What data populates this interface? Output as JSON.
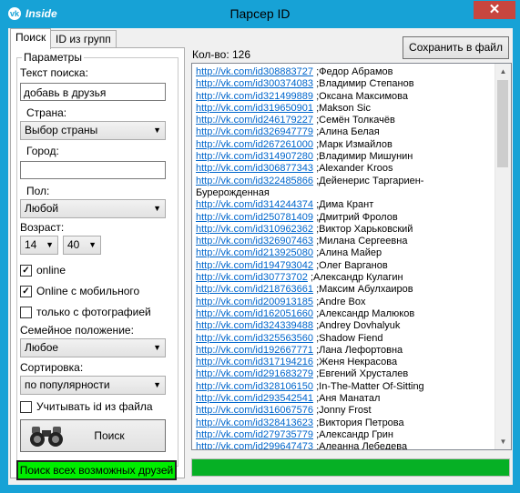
{
  "titlebar": {
    "logo_glyph": "vk",
    "logo_text": "Inside",
    "title": "Парсер ID",
    "close_glyph": "✕"
  },
  "tabs": [
    {
      "label": "Поиск",
      "active": true
    },
    {
      "label": "ID из групп",
      "active": false
    }
  ],
  "params": {
    "group_title": "Параметры",
    "search_text_label": "Текст поиска:",
    "search_text_value": "добавь в друзья",
    "country_label": "Страна:",
    "country_value": "Выбор страны",
    "city_label": "Город:",
    "city_value": "",
    "gender_label": "Пол:",
    "gender_value": "Любой",
    "age_label": "Возраст:",
    "age_from": "14",
    "age_to": "40",
    "online_label": "online",
    "online_checked": true,
    "online_mobile_label": "Online с мобильного",
    "online_mobile_checked": true,
    "photo_only_label": "только с фотографией",
    "photo_only_checked": false,
    "family_label": "Семейное положение:",
    "family_value": "Любое",
    "sort_label": "Сортировка:",
    "sort_value": "по популярности",
    "use_file_ids_label": "Учитывать id из файла",
    "use_file_ids_checked": false,
    "search_button_label": "Поиск",
    "check_glyph": "✓",
    "dropdown_glyph": "▼"
  },
  "search_all_button_label": "Поиск всех возможных друзей",
  "results": {
    "count_label": "Кол-во: 126",
    "save_button_label": "Сохранить в файл",
    "rows": [
      {
        "url": "http://vk.com/id308883727",
        "name": " ;Федор Абрамов"
      },
      {
        "url": "http://vk.com/id300374083",
        "name": " ;Владимир Степанов"
      },
      {
        "url": "http://vk.com/id321499889",
        "name": " ;Оксана Максимова"
      },
      {
        "url": "http://vk.com/id319650901",
        "name": " ;Makson Sic"
      },
      {
        "url": "http://vk.com/id246179227",
        "name": " ;Семён Толкачёв"
      },
      {
        "url": "http://vk.com/id326947779",
        "name": " ;Алина Белая"
      },
      {
        "url": "http://vk.com/id267261000",
        "name": " ;Марк Измайлов"
      },
      {
        "url": "http://vk.com/id314907280",
        "name": " ;Владимир Мишунин"
      },
      {
        "url": "http://vk.com/id306877343",
        "name": " ;Alexander Kroos"
      },
      {
        "url": "http://vk.com/id322485866",
        "name": " ;Дейенерис Таргариен-"
      },
      {
        "url": "",
        "name": "Бурерожденная"
      },
      {
        "url": "http://vk.com/id314244374",
        "name": " ;Дима Крант"
      },
      {
        "url": "http://vk.com/id250781409",
        "name": " ;Дмитрий Фролов"
      },
      {
        "url": "http://vk.com/id310962362",
        "name": " ;Виктор Харьковский"
      },
      {
        "url": "http://vk.com/id326907463",
        "name": " ;Милана Сергеевна"
      },
      {
        "url": "http://vk.com/id213925080",
        "name": " ;Алина Майер"
      },
      {
        "url": "http://vk.com/id194793042",
        "name": " ;Олег Варганов"
      },
      {
        "url": "http://vk.com/id30773702",
        "name": " ;Александр Кулагин"
      },
      {
        "url": "http://vk.com/id218763661",
        "name": " ;Максим Абулхаиров"
      },
      {
        "url": "http://vk.com/id200913185",
        "name": " ;Andre Box"
      },
      {
        "url": "http://vk.com/id162051660",
        "name": " ;Александр Малюков"
      },
      {
        "url": "http://vk.com/id324339488",
        "name": " ;Andrey Dovhalyuk"
      },
      {
        "url": "http://vk.com/id325563560",
        "name": " ;Shadow Fiend"
      },
      {
        "url": "http://vk.com/id192667771",
        "name": " ;Лана Лефортовна"
      },
      {
        "url": "http://vk.com/id317194216",
        "name": " ;Женя Некрасова"
      },
      {
        "url": "http://vk.com/id291683279",
        "name": " ;Евгений Хрусталев"
      },
      {
        "url": "http://vk.com/id328106150",
        "name": " ;In-The-Matter Of-Sitting"
      },
      {
        "url": "http://vk.com/id293542541",
        "name": " ;Аня Манатал"
      },
      {
        "url": "http://vk.com/id316067576",
        "name": " ;Jonny Frost"
      },
      {
        "url": "http://vk.com/id328413623",
        "name": " ;Виктория Петрова"
      },
      {
        "url": "http://vk.com/id279735779",
        "name": " ;Александр Грин"
      },
      {
        "url": "http://vk.com/id299647473",
        "name": " ;Алеанна Лебедева"
      }
    ],
    "scroll_up_glyph": "▲",
    "scroll_down_glyph": "▼"
  },
  "progress": {
    "fraction": 1.0
  },
  "colors": {
    "titlebar": "#17a2d6",
    "close": "#c7463f",
    "progress": "#06b025",
    "search_all_bg": "#00ee00",
    "link": "#0066cc"
  }
}
